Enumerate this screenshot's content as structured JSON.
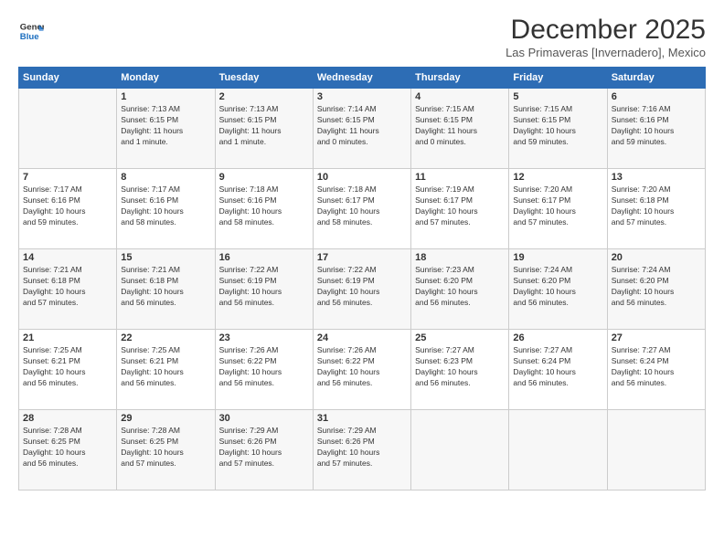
{
  "header": {
    "logo_line1": "General",
    "logo_line2": "Blue",
    "title": "December 2025",
    "subtitle": "Las Primaveras [Invernadero], Mexico"
  },
  "columns": [
    "Sunday",
    "Monday",
    "Tuesday",
    "Wednesday",
    "Thursday",
    "Friday",
    "Saturday"
  ],
  "weeks": [
    [
      {
        "day": "",
        "info": ""
      },
      {
        "day": "1",
        "info": "Sunrise: 7:13 AM\nSunset: 6:15 PM\nDaylight: 11 hours\nand 1 minute."
      },
      {
        "day": "2",
        "info": "Sunrise: 7:13 AM\nSunset: 6:15 PM\nDaylight: 11 hours\nand 1 minute."
      },
      {
        "day": "3",
        "info": "Sunrise: 7:14 AM\nSunset: 6:15 PM\nDaylight: 11 hours\nand 0 minutes."
      },
      {
        "day": "4",
        "info": "Sunrise: 7:15 AM\nSunset: 6:15 PM\nDaylight: 11 hours\nand 0 minutes."
      },
      {
        "day": "5",
        "info": "Sunrise: 7:15 AM\nSunset: 6:15 PM\nDaylight: 10 hours\nand 59 minutes."
      },
      {
        "day": "6",
        "info": "Sunrise: 7:16 AM\nSunset: 6:16 PM\nDaylight: 10 hours\nand 59 minutes."
      }
    ],
    [
      {
        "day": "7",
        "info": "Sunrise: 7:17 AM\nSunset: 6:16 PM\nDaylight: 10 hours\nand 59 minutes."
      },
      {
        "day": "8",
        "info": "Sunrise: 7:17 AM\nSunset: 6:16 PM\nDaylight: 10 hours\nand 58 minutes."
      },
      {
        "day": "9",
        "info": "Sunrise: 7:18 AM\nSunset: 6:16 PM\nDaylight: 10 hours\nand 58 minutes."
      },
      {
        "day": "10",
        "info": "Sunrise: 7:18 AM\nSunset: 6:17 PM\nDaylight: 10 hours\nand 58 minutes."
      },
      {
        "day": "11",
        "info": "Sunrise: 7:19 AM\nSunset: 6:17 PM\nDaylight: 10 hours\nand 57 minutes."
      },
      {
        "day": "12",
        "info": "Sunrise: 7:20 AM\nSunset: 6:17 PM\nDaylight: 10 hours\nand 57 minutes."
      },
      {
        "day": "13",
        "info": "Sunrise: 7:20 AM\nSunset: 6:18 PM\nDaylight: 10 hours\nand 57 minutes."
      }
    ],
    [
      {
        "day": "14",
        "info": "Sunrise: 7:21 AM\nSunset: 6:18 PM\nDaylight: 10 hours\nand 57 minutes."
      },
      {
        "day": "15",
        "info": "Sunrise: 7:21 AM\nSunset: 6:18 PM\nDaylight: 10 hours\nand 56 minutes."
      },
      {
        "day": "16",
        "info": "Sunrise: 7:22 AM\nSunset: 6:19 PM\nDaylight: 10 hours\nand 56 minutes."
      },
      {
        "day": "17",
        "info": "Sunrise: 7:22 AM\nSunset: 6:19 PM\nDaylight: 10 hours\nand 56 minutes."
      },
      {
        "day": "18",
        "info": "Sunrise: 7:23 AM\nSunset: 6:20 PM\nDaylight: 10 hours\nand 56 minutes."
      },
      {
        "day": "19",
        "info": "Sunrise: 7:24 AM\nSunset: 6:20 PM\nDaylight: 10 hours\nand 56 minutes."
      },
      {
        "day": "20",
        "info": "Sunrise: 7:24 AM\nSunset: 6:20 PM\nDaylight: 10 hours\nand 56 minutes."
      }
    ],
    [
      {
        "day": "21",
        "info": "Sunrise: 7:25 AM\nSunset: 6:21 PM\nDaylight: 10 hours\nand 56 minutes."
      },
      {
        "day": "22",
        "info": "Sunrise: 7:25 AM\nSunset: 6:21 PM\nDaylight: 10 hours\nand 56 minutes."
      },
      {
        "day": "23",
        "info": "Sunrise: 7:26 AM\nSunset: 6:22 PM\nDaylight: 10 hours\nand 56 minutes."
      },
      {
        "day": "24",
        "info": "Sunrise: 7:26 AM\nSunset: 6:22 PM\nDaylight: 10 hours\nand 56 minutes."
      },
      {
        "day": "25",
        "info": "Sunrise: 7:27 AM\nSunset: 6:23 PM\nDaylight: 10 hours\nand 56 minutes."
      },
      {
        "day": "26",
        "info": "Sunrise: 7:27 AM\nSunset: 6:24 PM\nDaylight: 10 hours\nand 56 minutes."
      },
      {
        "day": "27",
        "info": "Sunrise: 7:27 AM\nSunset: 6:24 PM\nDaylight: 10 hours\nand 56 minutes."
      }
    ],
    [
      {
        "day": "28",
        "info": "Sunrise: 7:28 AM\nSunset: 6:25 PM\nDaylight: 10 hours\nand 56 minutes."
      },
      {
        "day": "29",
        "info": "Sunrise: 7:28 AM\nSunset: 6:25 PM\nDaylight: 10 hours\nand 57 minutes."
      },
      {
        "day": "30",
        "info": "Sunrise: 7:29 AM\nSunset: 6:26 PM\nDaylight: 10 hours\nand 57 minutes."
      },
      {
        "day": "31",
        "info": "Sunrise: 7:29 AM\nSunset: 6:26 PM\nDaylight: 10 hours\nand 57 minutes."
      },
      {
        "day": "",
        "info": ""
      },
      {
        "day": "",
        "info": ""
      },
      {
        "day": "",
        "info": ""
      }
    ]
  ]
}
